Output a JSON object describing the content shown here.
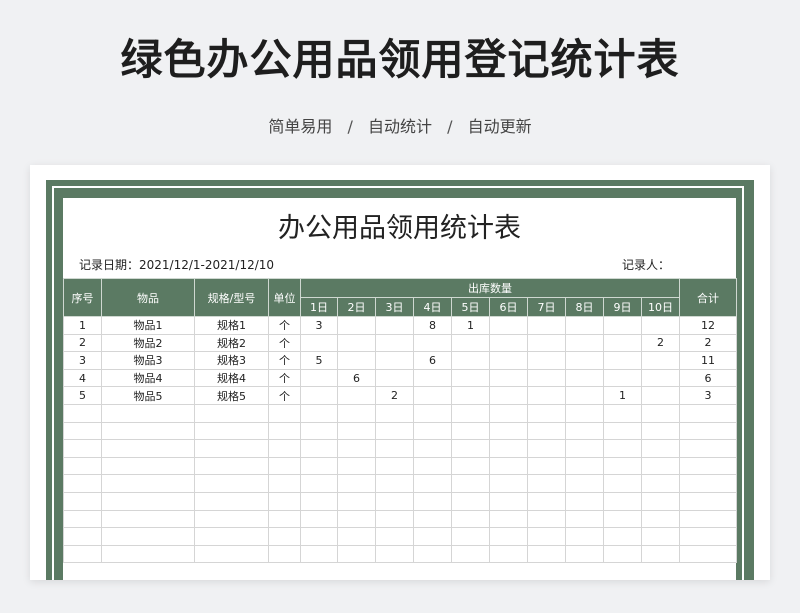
{
  "header": {
    "title": "绿色办公用品领用登记统计表",
    "subtitle_items": [
      "简单易用",
      "自动统计",
      "自动更新"
    ],
    "subtitle_sep": "/"
  },
  "sheet": {
    "title": "办公用品领用统计表",
    "record_date": "记录日期：2021/12/1-2021/12/10",
    "recorder": "记录人：",
    "columns": {
      "index": "序号",
      "item": "物品",
      "spec": "规格/型号",
      "unit": "单位",
      "outbound": "出库数量",
      "days": [
        "1日",
        "2日",
        "3日",
        "4日",
        "5日",
        "6日",
        "7日",
        "8日",
        "9日",
        "10日"
      ],
      "total": "合计"
    },
    "rows": [
      {
        "index": "1",
        "item": "物品1",
        "spec": "规格1",
        "unit": "个",
        "days": [
          "3",
          "",
          "",
          "8",
          "1",
          "",
          "",
          "",
          "",
          ""
        ],
        "total": "12"
      },
      {
        "index": "2",
        "item": "物品2",
        "spec": "规格2",
        "unit": "个",
        "days": [
          "",
          "",
          "",
          "",
          "",
          "",
          "",
          "",
          "",
          "2"
        ],
        "total": "2"
      },
      {
        "index": "3",
        "item": "物品3",
        "spec": "规格3",
        "unit": "个",
        "days": [
          "5",
          "",
          "",
          "6",
          "",
          "",
          "",
          "",
          "",
          ""
        ],
        "total": "11"
      },
      {
        "index": "4",
        "item": "物品4",
        "spec": "规格4",
        "unit": "个",
        "days": [
          "",
          "6",
          "",
          "",
          "",
          "",
          "",
          "",
          "",
          ""
        ],
        "total": "6"
      },
      {
        "index": "5",
        "item": "物品5",
        "spec": "规格5",
        "unit": "个",
        "days": [
          "",
          "",
          "2",
          "",
          "",
          "",
          "",
          "",
          "1",
          ""
        ],
        "total": "3"
      }
    ],
    "empty_rows": 9,
    "colors": {
      "header_green": "#5b7a63",
      "background": "#f0f1f3"
    }
  }
}
